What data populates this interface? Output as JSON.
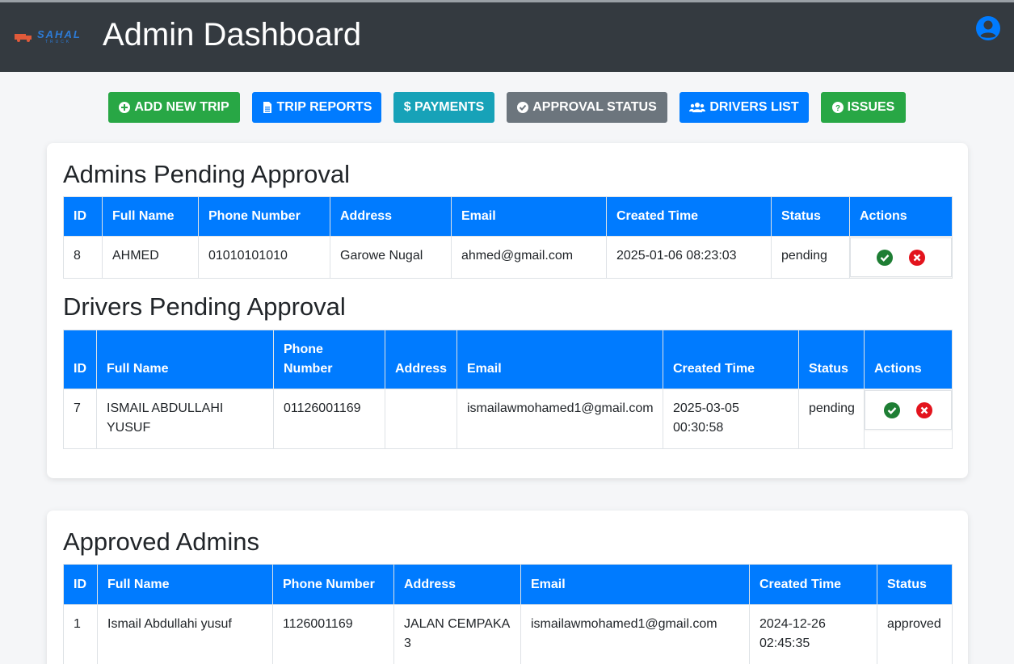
{
  "brand": {
    "name": "SAHAL",
    "sub": "TRUCK"
  },
  "header": {
    "title": "Admin Dashboard"
  },
  "nav": {
    "add_trip": "ADD NEW TRIP",
    "trip_reports": "TRIP REPORTS",
    "payments": "$ PAYMENTS",
    "approval_status": "APPROVAL STATUS",
    "drivers_list": "DRIVERS LIST",
    "issues": "ISSUES"
  },
  "colors": {
    "primary": "#007bff",
    "success": "#28a745",
    "info": "#17a2b8",
    "secondary": "#6c757d",
    "danger": "#dc3545",
    "approve_icon": "#1e7e34",
    "reject_icon": "#e3141d",
    "topbar": "#343a40"
  },
  "admins_pending": {
    "title": "Admins Pending Approval",
    "headers": [
      "ID",
      "Full Name",
      "Phone Number",
      "Address",
      "Email",
      "Created Time",
      "Status",
      "Actions"
    ],
    "rows": [
      {
        "id": "8",
        "name": "AHMED",
        "phone": "01010101010",
        "address": "Garowe Nugal",
        "email": "ahmed@gmail.com",
        "created": "2025-01-06 08:23:03",
        "status": "pending"
      }
    ]
  },
  "drivers_pending": {
    "title": "Drivers Pending Approval",
    "headers": [
      "ID",
      "Full Name",
      "Phone Number",
      "Address",
      "Email",
      "Created Time",
      "Status",
      "Actions"
    ],
    "rows": [
      {
        "id": "7",
        "name": "ISMAIL ABDULLAHI YUSUF",
        "phone": "01126001169",
        "address": "",
        "email": "ismailawmohamed1@gmail.com",
        "created": "2025-03-05 00:30:58",
        "status": "pending"
      }
    ]
  },
  "approved_admins": {
    "title": "Approved Admins",
    "headers": [
      "ID",
      "Full Name",
      "Phone Number",
      "Address",
      "Email",
      "Created Time",
      "Status"
    ],
    "rows": [
      {
        "id": "1",
        "name": "Ismail Abdullahi yusuf",
        "phone": "1126001169",
        "address": "JALAN CEMPAKA 3",
        "email": "ismailawmohamed1@gmail.com",
        "created": "2024-12-26 02:45:35",
        "status": "approved"
      }
    ]
  }
}
